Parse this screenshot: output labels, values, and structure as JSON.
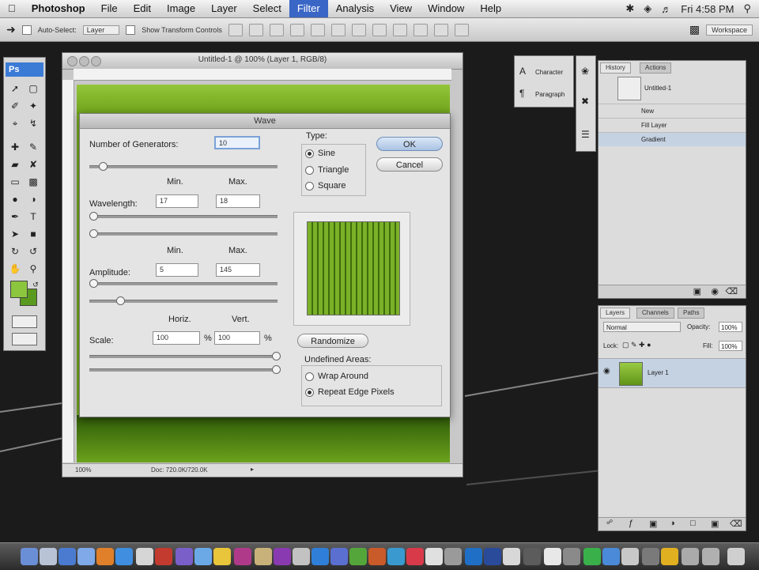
{
  "menubar": {
    "app": "Photoshop",
    "items": [
      "File",
      "Edit",
      "Image",
      "Layer",
      "Select",
      "Filter",
      "Analysis",
      "View",
      "Window",
      "Help"
    ],
    "active": "Filter",
    "clock": "Fri 4:58 PM"
  },
  "options": {
    "auto_select": "Auto-Select:",
    "auto_select_value": "Layer",
    "show_transform": "Show Transform Controls",
    "workspace": "Workspace"
  },
  "tools": {
    "logo": "Ps"
  },
  "document": {
    "title": "Untitled-1 @ 100% (Layer 1, RGB/8)",
    "zoom": "100%",
    "doc_info": "Doc: 720.0K/720.0K"
  },
  "wave": {
    "title": "Wave",
    "generators_label": "Number of Generators:",
    "generators_value": "10",
    "type_label": "Type:",
    "types": [
      "Sine",
      "Triangle",
      "Square"
    ],
    "type_selected": "Sine",
    "ok": "OK",
    "cancel": "Cancel",
    "min_label": "Min.",
    "max_label": "Max.",
    "wavelength_label": "Wavelength:",
    "wavelength_min": "17",
    "wavelength_max": "18",
    "amplitude_label": "Amplitude:",
    "amplitude_min": "5",
    "amplitude_max": "145",
    "horiz_label": "Horiz.",
    "vert_label": "Vert.",
    "scale_label": "Scale:",
    "scale_h": "100",
    "scale_v": "100",
    "pct": "%",
    "randomize": "Randomize",
    "undefined_label": "Undefined Areas:",
    "undefined_options": [
      "Wrap Around",
      "Repeat Edge Pixels"
    ],
    "undefined_selected": "Repeat Edge Pixels"
  },
  "panels": {
    "char_tabs": [
      "Character",
      "Paragraph"
    ],
    "history_tabs": [
      "History",
      "Actions"
    ],
    "history_snapshot": "Untitled-1",
    "history_items": [
      "New",
      "Fill Layer",
      "Gradient"
    ],
    "layers_tabs": [
      "Layers",
      "Channels",
      "Paths"
    ],
    "blend_mode": "Normal",
    "opacity_label": "Opacity:",
    "opacity_value": "100%",
    "lock_label": "Lock:",
    "fill_label": "Fill:",
    "fill_value": "100%",
    "layer_name": "Layer 1"
  },
  "colors": {
    "accent": "#3a66c6",
    "foreground": "#8cc63f",
    "background": "#5a9a1e",
    "canvas_green": "#7aae20"
  }
}
